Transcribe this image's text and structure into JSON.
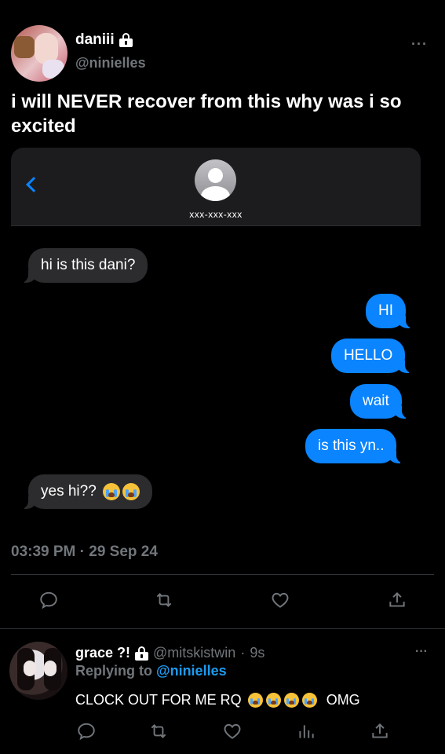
{
  "post": {
    "display_name": "daniii",
    "handle": "@ninielles",
    "text": "i will NEVER recover from this why was i so excited",
    "timestamp": "03:39 PM · 29 Sep 24",
    "more": "···"
  },
  "imessage": {
    "contact_number": "xxx-xxx-xxx",
    "messages": [
      {
        "dir": "in",
        "text": "hi is this dani?"
      },
      {
        "dir": "out",
        "text": "HI"
      },
      {
        "dir": "out",
        "text": "HELLO"
      },
      {
        "dir": "out",
        "text": "wait"
      },
      {
        "dir": "out",
        "text": "is this yn.."
      },
      {
        "dir": "in",
        "text": "yes hi??"
      }
    ]
  },
  "actions": {
    "icons": [
      "reply-icon",
      "retweet-icon",
      "like-icon",
      "share-icon"
    ]
  },
  "reply": {
    "display_name": "grace ?!",
    "handle": "@mitskistwin",
    "separator": "·",
    "time": "9s",
    "replying_prefix": "Replying to",
    "replying_to": "@ninielles",
    "text": "CLOCK OUT FOR ME RQ",
    "text_suffix": "OMG",
    "more": "···",
    "icons": [
      "reply-icon",
      "retweet-icon",
      "like-icon",
      "views-icon",
      "share-icon"
    ]
  },
  "colors": {
    "background": "#000000",
    "muted": "#71767b",
    "link": "#1d9bf0",
    "bubble_out": "#0a84ff",
    "bubble_in": "#2c2c2e"
  }
}
